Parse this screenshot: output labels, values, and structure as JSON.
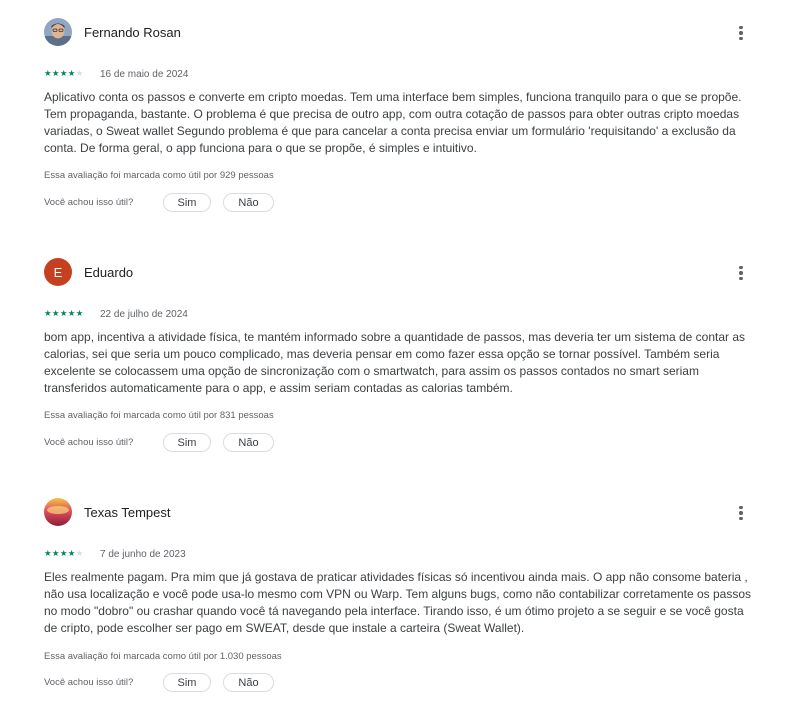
{
  "reviews": [
    {
      "name": "Fernando Rosan",
      "avatar_initial": "",
      "avatar_color": "#7a8fa6",
      "rating": 4,
      "date": "16 de maio de 2024",
      "text": "Aplicativo conta os passos e converte em cripto moedas. Tem uma interface bem simples, funciona tranquilo para o que se propõe. Tem propaganda, bastante. O problema é que precisa de outro app, com outra cotação de passos para obter outras cripto moedas variadas, o Sweat wallet Segundo problema é que para cancelar a conta precisa enviar um formulário 'requisitando' a exclusão da conta. De forma geral, o app funciona para o que se propõe, é simples e intuitivo.",
      "helpful_count_text": "Essa avaliação foi marcada como útil por 929 pessoas"
    },
    {
      "name": "Eduardo",
      "avatar_initial": "E",
      "avatar_color": "#c5401f",
      "rating": 5,
      "date": "22 de julho de 2024",
      "text": "bom app, incentiva a atividade física, te mantém informado sobre a quantidade de passos, mas deveria ter um sistema de contar as calorias, sei que seria um pouco complicado, mas deveria pensar em como fazer essa opção se tornar possível. Também seria excelente se colocassem uma opção de sincronização com o smartwatch, para assim os passos contados no smart seriam transferidos automaticamente para o app, e assim seriam contadas as calorias também.",
      "helpful_count_text": "Essa avaliação foi marcada como útil por 831 pessoas"
    },
    {
      "name": "Texas Tempest",
      "avatar_initial": "",
      "avatar_color": "#d43d55",
      "rating": 4,
      "date": "7 de junho de 2023",
      "text": "Eles realmente pagam. Pra mim que já gostava de praticar atividades físicas só incentivou ainda mais. O app não consome bateria , não usa localização e você pode usa-lo mesmo com VPN ou Warp. Tem alguns bugs, como não contabilizar corretamente os passos no modo \"dobro\" ou crashar quando você tá navegando pela interface. Tirando isso, é um ótimo projeto a se seguir e se você gosta de cripto, pode escolher ser pago em SWEAT, desde que instale a carteira (Sweat Wallet).",
      "helpful_count_text": "Essa avaliação foi marcada como útil por 1.030 pessoas"
    }
  ],
  "helpful_question": "Você achou isso útil?",
  "yes_label": "Sim",
  "no_label": "Não",
  "colors": {
    "star_filled": "#01875f",
    "star_empty": "#dadce0"
  }
}
